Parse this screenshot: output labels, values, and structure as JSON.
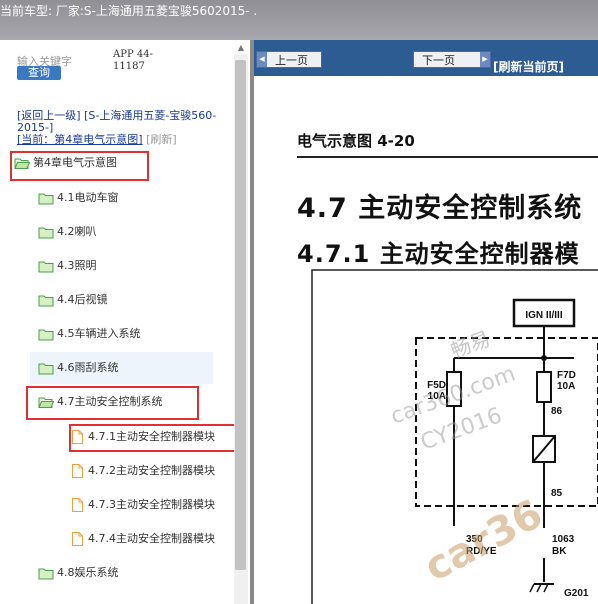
{
  "header": {
    "title": "当前车型:   厂家:S-上海通用五菱宝骏5602015-   ."
  },
  "search": {
    "hint": "输入关键字",
    "button": "查询"
  },
  "app_code": "APP 44-11187",
  "nav": {
    "back": "[返回上一级]",
    "car": "[S-上海通用五菱-宝骏560-2015-]",
    "current": "[当前：第4章电气示意图]",
    "refresh": "[刷新]"
  },
  "tree": {
    "chapter": "第4章电气示意图",
    "items": [
      "4.1电动车窗",
      "4.2喇叭",
      "4.3照明",
      "4.4后视镜",
      "4.5车辆进入系统",
      "4.6雨刮系统",
      "4.7主动安全控制系统"
    ],
    "subitems": [
      "4.7.1主动安全控制器模块",
      "4.7.2主动安全控制器模块",
      "4.7.3主动安全控制器模块",
      "4.7.4主动安全控制器模块"
    ],
    "after": "4.8娱乐系统"
  },
  "toolbar": {
    "prev": "上一页",
    "next": "下一页",
    "refresh": "[刷新当前页]"
  },
  "document": {
    "title": "电气示意图 4-20",
    "h1": "4.7 主动安全控制系统",
    "h2": "4.7.1 主动安全控制器模",
    "diagram": {
      "ign": "IGN II/III",
      "fuse1_name": "F5D",
      "fuse1_rating": "10A",
      "fuse2_name": "F7D",
      "fuse2_rating": "10A",
      "pin86": "86",
      "pin85": "85",
      "wire1_num": "350",
      "wire1_color": "RD/YE",
      "wire2_num": "1063",
      "wire2_color": "BK",
      "ground": "G201",
      "watermark1": "畅易",
      "watermark2": "car360.com",
      "watermark3": "CY2016",
      "watermark4": "car36"
    }
  }
}
